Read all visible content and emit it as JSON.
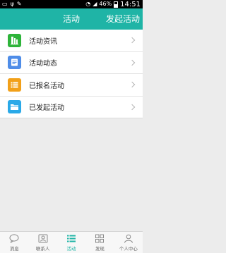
{
  "status_bar": {
    "signal_label": "46%",
    "time": "14:51"
  },
  "header": {
    "title": "活动",
    "action_label": "发起活动",
    "background": "#1fb4a6"
  },
  "menu": {
    "items": [
      {
        "label": "活动资讯",
        "icon": "news-icon",
        "color": "#2eb43a"
      },
      {
        "label": "活动动态",
        "icon": "document-icon",
        "color": "#4f8de8"
      },
      {
        "label": "已报名活动",
        "icon": "list-icon",
        "color": "#f2a019"
      },
      {
        "label": "已发起活动",
        "icon": "folder-icon",
        "color": "#2aa9e8"
      }
    ]
  },
  "tabbar": {
    "active_color": "#1fb4a6",
    "tabs": [
      {
        "label": "消息",
        "icon": "chat-bubble-icon"
      },
      {
        "label": "联系人",
        "icon": "contact-card-icon"
      },
      {
        "label": "活动",
        "icon": "list-icon",
        "active": true
      },
      {
        "label": "发现",
        "icon": "grid-icon"
      },
      {
        "label": "个人中心",
        "icon": "person-icon"
      }
    ]
  }
}
